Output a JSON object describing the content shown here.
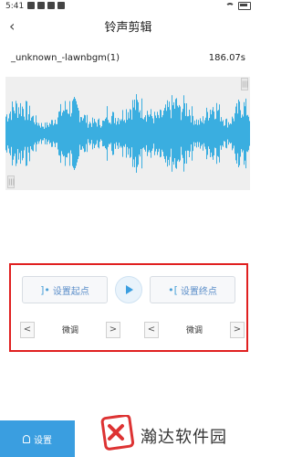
{
  "status_bar": {
    "time": "5:41"
  },
  "header": {
    "title": "铃声剪辑"
  },
  "file": {
    "name": "_unknown_-lawnbgm(1)",
    "duration": "186.07s"
  },
  "controls": {
    "set_start_label": "设置起点",
    "set_end_label": "设置终点",
    "fine_tune_start": "微调",
    "fine_tune_end": "微调",
    "prev_glyph": "<",
    "next_glyph": ">"
  },
  "bottom": {
    "settings_label": "设置"
  },
  "watermark": {
    "text": "瀚达软件园"
  },
  "colors": {
    "accent": "#3a9ee0",
    "waveform": "#3aaee0",
    "waveform_bg": "#efefef",
    "highlight_border": "#e02020"
  }
}
